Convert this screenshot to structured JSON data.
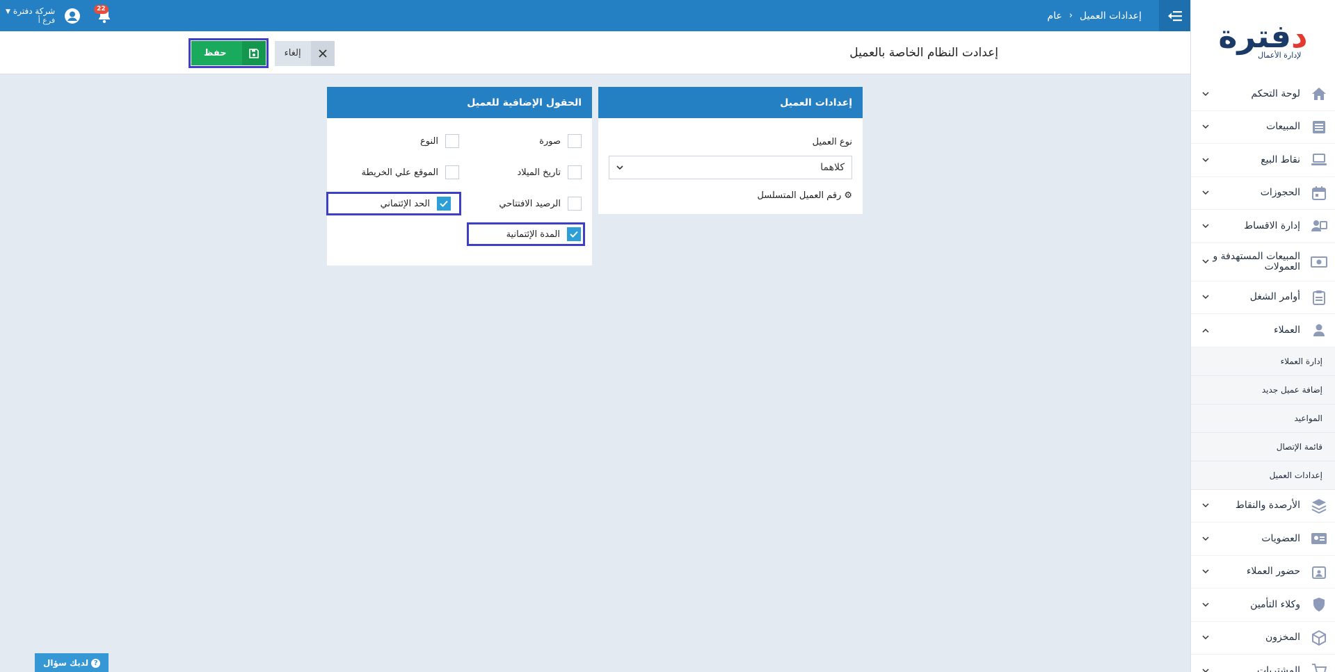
{
  "brand": {
    "logo_text": "دفترة",
    "logo_sub": "لإدارة الأعمال",
    "accent": "#e4392f",
    "primary": "#2580c3"
  },
  "topbar": {
    "breadcrumb": [
      "إعدادات العميل",
      "عام"
    ],
    "company": "شركة دفترة",
    "branch": "فرع أ",
    "notifications_count": "22"
  },
  "page": {
    "title": "إعدادت النظام الخاصة بالعميل",
    "save_label": "حفظ",
    "cancel_label": "إلغاء"
  },
  "client_settings": {
    "title": "إعدادات العميل",
    "type_label": "نوع العميل",
    "type_value": "كلاهما",
    "serial_link": "رقم العميل المتسلسل"
  },
  "extra_fields": {
    "title": "الحقول الإضافية للعميل",
    "fields": [
      {
        "label": "صورة",
        "checked": false
      },
      {
        "label": "النوع",
        "checked": false
      },
      {
        "label": "تاريخ الميلاد",
        "checked": false
      },
      {
        "label": "الموقع علي الخريطة",
        "checked": false
      },
      {
        "label": "الرصيد الافتتاحي",
        "checked": false
      },
      {
        "label": "الحد الإئتماني",
        "checked": true
      },
      {
        "label": "المدة الإئتمانية",
        "checked": true
      }
    ]
  },
  "sidebar": {
    "items": [
      {
        "label": "لوحة التحكم",
        "icon": "home-icon"
      },
      {
        "label": "المبيعات",
        "icon": "document-icon"
      },
      {
        "label": "نقاط البيع",
        "icon": "laptop-icon"
      },
      {
        "label": "الحجوزات",
        "icon": "calendar-icon"
      },
      {
        "label": "إدارة الاقساط",
        "icon": "id-card-icon"
      },
      {
        "label": "المبيعات المستهدفة و العمولات",
        "icon": "money-icon"
      },
      {
        "label": "أوامر الشغل",
        "icon": "clipboard-icon"
      },
      {
        "label": "العملاء",
        "icon": "user-icon"
      }
    ],
    "sub_items": [
      "إدارة العملاء",
      "إضافة عميل جديد",
      "المواعيد",
      "قائمة الإتصال",
      "إعدادات العميل"
    ],
    "items_after": [
      {
        "label": "الأرصدة والنقاط",
        "icon": "layers-icon"
      },
      {
        "label": "العضويات",
        "icon": "membership-icon"
      },
      {
        "label": "حضور العملاء",
        "icon": "attendance-icon"
      },
      {
        "label": "وكلاء التأمين",
        "icon": "shield-icon"
      },
      {
        "label": "المخزون",
        "icon": "box-icon"
      },
      {
        "label": "المشتريات",
        "icon": "cart-icon"
      }
    ]
  },
  "help": {
    "label": "لديك سؤال"
  }
}
